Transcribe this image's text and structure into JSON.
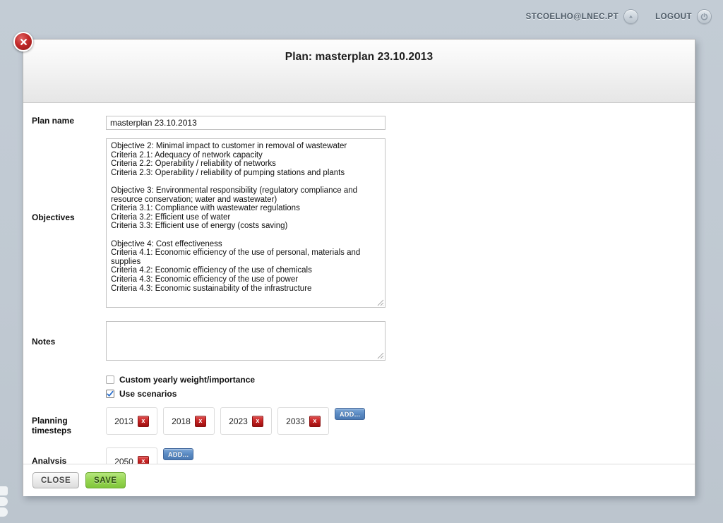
{
  "topbar": {
    "user_email": "STCOELHO@LNEC.PT",
    "user_icon": "user-chevron-icon",
    "logout_label": "LOGOUT",
    "logout_icon": "power-icon"
  },
  "dialog": {
    "title": "Plan: masterplan 23.10.2013",
    "close_icon": "close-icon"
  },
  "form": {
    "plan_name": {
      "label": "Plan name",
      "value": "masterplan 23.10.2013",
      "placeholder": ""
    },
    "objectives": {
      "label": "Objectives",
      "value": "Objective 2: Minimal impact to customer in removal of wastewater\nCriteria 2.1: Adequacy of network capacity\nCriteria 2.2: Operability / reliability of networks\nCriteria 2.3: Operability / reliability of pumping stations and plants\n\nObjective 3: Environmental responsibility (regulatory compliance and\nresource conservation; water and wastewater)\nCriteria 3.1: Compliance with wastewater regulations\nCriteria 3.2: Efficient use of water\nCriteria 3.3: Efficient use of energy (costs saving)\n\nObjective 4: Cost effectiveness\nCriteria 4.1: Economic efficiency of the use of personal, materials and\nsupplies\nCriteria 4.2: Economic efficiency of the use of chemicals\nCriteria 4.3: Economic efficiency of the use of power\nCriteria 4.3: Economic sustainability of the infrastructure",
      "placeholder": ""
    },
    "notes": {
      "label": "Notes",
      "value": "",
      "placeholder": ""
    },
    "custom_weight": {
      "label": "Custom yearly weight/importance",
      "checked": false
    },
    "use_scenarios": {
      "label": "Use scenarios",
      "checked": true
    },
    "planning_timesteps": {
      "label": "Planning timesteps",
      "years": [
        "2013",
        "2018",
        "2023",
        "2033"
      ],
      "add_label": "ADD...",
      "delete_label": "x"
    },
    "analysis_timesteps": {
      "label": "Analysis timesteps",
      "years": [
        "2050"
      ],
      "add_label": "ADD...",
      "delete_label": "x"
    }
  },
  "footer": {
    "close_label": "CLOSE",
    "save_label": "SAVE"
  },
  "colors": {
    "page_background": "#c0c9d2",
    "dialog_background": "#ffffff",
    "accent_blue": "#5b8bc4",
    "danger_red": "#c42222",
    "success_green": "#97d652"
  }
}
